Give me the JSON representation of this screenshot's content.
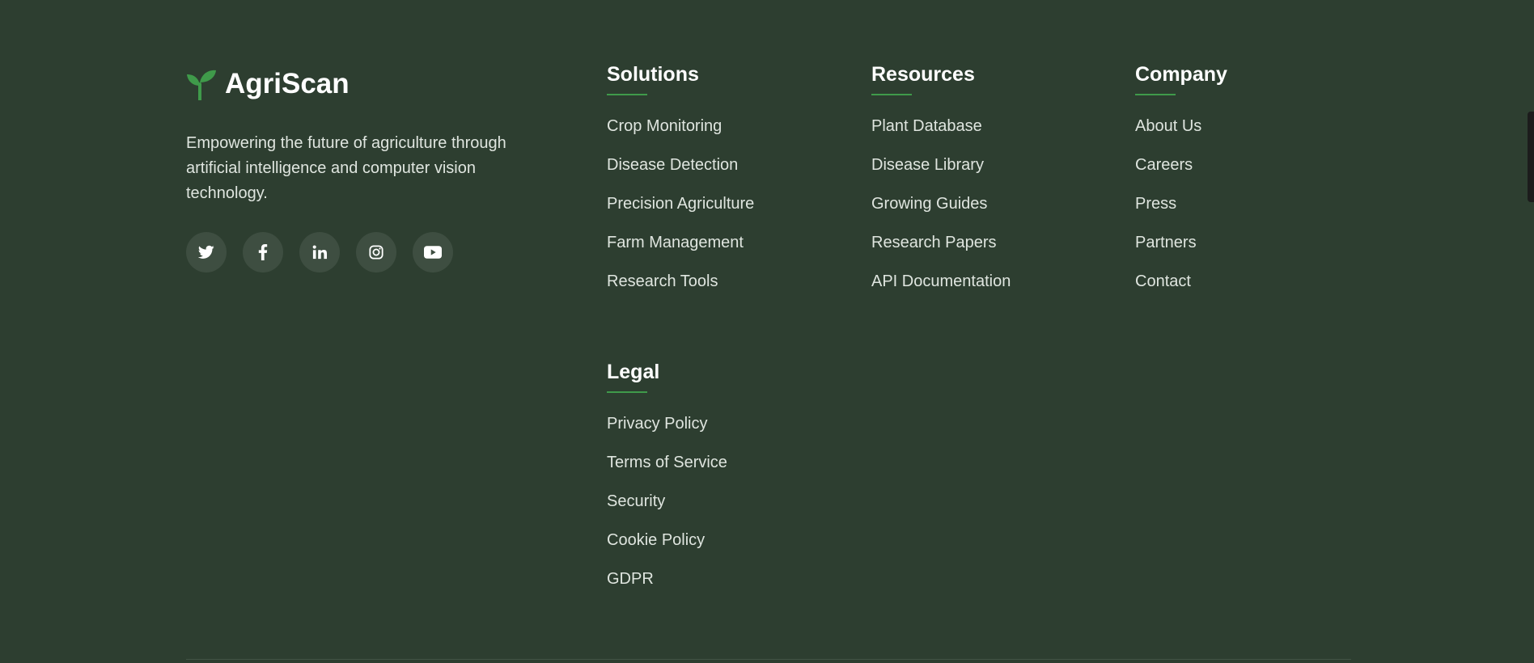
{
  "brand": {
    "name": "AgriScan",
    "icon": "sprout-icon",
    "tagline": "Empowering the future of agriculture through artificial intelligence and computer vision technology."
  },
  "socials": [
    {
      "name": "twitter-icon"
    },
    {
      "name": "facebook-icon"
    },
    {
      "name": "linkedin-icon"
    },
    {
      "name": "instagram-icon"
    },
    {
      "name": "youtube-icon"
    }
  ],
  "columns": {
    "solutions": {
      "title": "Solutions",
      "links": [
        "Crop Monitoring",
        "Disease Detection",
        "Precision Agriculture",
        "Farm Management",
        "Research Tools"
      ]
    },
    "resources": {
      "title": "Resources",
      "links": [
        "Plant Database",
        "Disease Library",
        "Growing Guides",
        "Research Papers",
        "API Documentation"
      ]
    },
    "company": {
      "title": "Company",
      "links": [
        "About Us",
        "Careers",
        "Press",
        "Partners",
        "Contact"
      ]
    },
    "legal": {
      "title": "Legal",
      "links": [
        "Privacy Policy",
        "Terms of Service",
        "Security",
        "Cookie Policy",
        "GDPR"
      ]
    }
  },
  "colors": {
    "background": "#2d3e30",
    "accent": "#3f9a4a",
    "social_bg": "#3e4e41",
    "text": "#dfe5df"
  }
}
